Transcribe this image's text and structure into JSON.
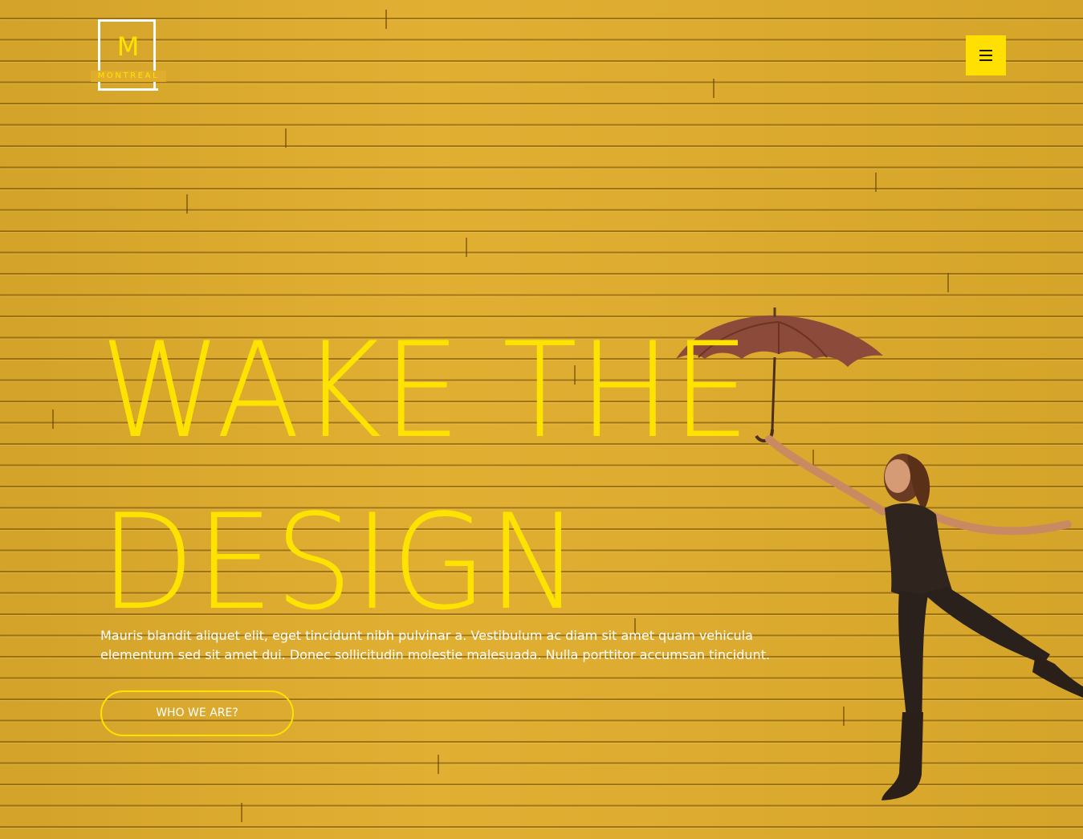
{
  "brand": {
    "logo_letter": "M",
    "logo_word": "MONTREAL"
  },
  "header": {
    "menu_icon": "hamburger-menu-icon"
  },
  "hero": {
    "headline_line1": "WAKE THE",
    "headline_line2": "DESIGN",
    "lead": "Mauris blandit aliquet elit, eget tincidunt nibh pulvinar a. Vestibulum ac diam sit amet quam vehicula elementum sed sit amet dui. Donec sollicitudin molestie malesuada. Nulla porttitor accumsan tincidunt.",
    "cta_label": "WHO WE ARE?",
    "image": "woman-with-umbrella-photo"
  },
  "colors": {
    "background": "#e0ad2c",
    "accent": "#ffe300",
    "text_light": "#ffffff"
  }
}
